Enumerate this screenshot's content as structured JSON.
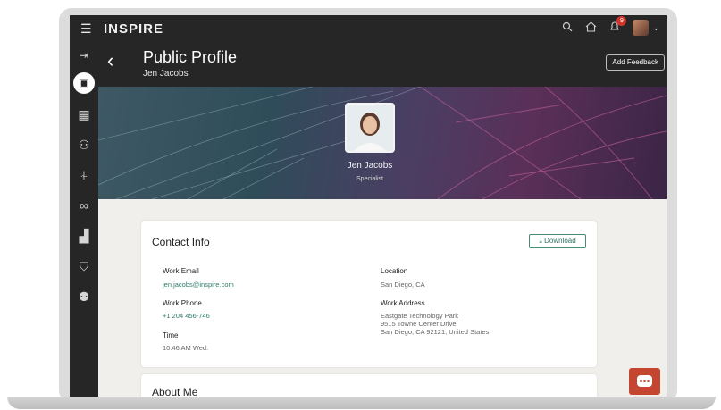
{
  "app": {
    "brand": "INSPIRE",
    "notification_count": "9"
  },
  "header": {
    "title": "Public Profile",
    "subtitle": "Jen Jacobs",
    "feedback_label": "Add Feedback"
  },
  "banner": {
    "name": "Jen Jacobs",
    "role": "Specialist"
  },
  "contact": {
    "title": "Contact Info",
    "download_label": "Download",
    "work_email_label": "Work Email",
    "work_email": "jen.jacobs@inspire.com",
    "work_phone_label": "Work Phone",
    "work_phone": "+1 204 456-746",
    "time_label": "Time",
    "time": "10:46 AM Wed.",
    "location_label": "Location",
    "location": "San Diego, CA",
    "address_label": "Work Address",
    "address_line1": "Eastgate Technology Park",
    "address_line2": "9515 Towne Center Drive",
    "address_line3": "San Diego, CA 92121, United States"
  },
  "about": {
    "title": "About Me"
  },
  "colors": {
    "topbar": "#262626",
    "accent": "#2f7a68",
    "chat": "#c44631",
    "badge": "#d0342c"
  },
  "icons": {
    "rail": [
      "collapse-icon",
      "profile-badge-icon",
      "building-icon",
      "people-money-icon",
      "signpost-icon",
      "glasses-icon",
      "growth-chart-icon",
      "user-shield-icon",
      "people-group-icon"
    ],
    "topbar": [
      "search-icon",
      "home-icon",
      "notifications-icon",
      "user-avatar",
      "chevron-down-icon"
    ]
  }
}
